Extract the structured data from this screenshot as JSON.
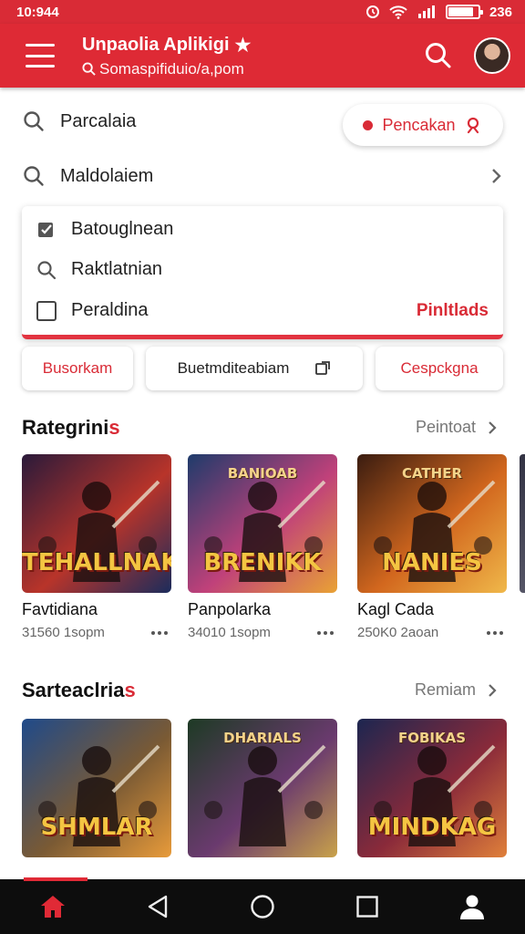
{
  "status": {
    "time": "10:944",
    "battery_text": "236",
    "battery_level": 0.85
  },
  "appbar": {
    "title": "Unpaolia Aplikigi",
    "subtitle": "Somaspifiduio/a,pom"
  },
  "search_rows": [
    {
      "label": "Parcalaia"
    },
    {
      "label": "Maldolaiem"
    }
  ],
  "pill": {
    "label": "Pencakan"
  },
  "dropdown": {
    "items": [
      {
        "label": "Batouglnean"
      },
      {
        "label": "Raktlatnian"
      },
      {
        "label": "Peraldina"
      }
    ],
    "action": "Pinltlads"
  },
  "chips": [
    {
      "label": "Busorkam"
    },
    {
      "label": "Buetmditeabiam"
    },
    {
      "label": "Cespckgna"
    }
  ],
  "sections": [
    {
      "title": "Rategrini",
      "title_accent": "s",
      "link": "Peintoat",
      "cards": [
        {
          "name": "Favtidiana",
          "meta": "31560 1sopm",
          "logo": "TEHALLNAK",
          "logo_top": "",
          "colors": [
            "#2a1a3a",
            "#b8342a",
            "#1b2c5c"
          ]
        },
        {
          "name": "Panpolarka",
          "meta": "34010 1sopm",
          "logo": "BRENIKK",
          "logo_top": "BANIOAB",
          "colors": [
            "#1e3b6b",
            "#c0417a",
            "#e9a234"
          ]
        },
        {
          "name": "Kagl Cada",
          "meta": "250K0 2aoan",
          "logo": "NANIES",
          "logo_top": "CATHER",
          "colors": [
            "#3a1c10",
            "#d2671e",
            "#f0b84a"
          ]
        }
      ]
    },
    {
      "title": "Sarteaclria",
      "title_accent": "s",
      "link": "Remiam",
      "cards": [
        {
          "name": "",
          "meta": "",
          "logo": "SHMLAR",
          "logo_top": "",
          "colors": [
            "#1f4a8a",
            "#7a5a34",
            "#e89b3a"
          ]
        },
        {
          "name": "",
          "meta": "",
          "logo": "",
          "logo_top": "DHARIALS",
          "colors": [
            "#1d3a24",
            "#6a3a6e",
            "#c9a24a"
          ]
        },
        {
          "name": "",
          "meta": "",
          "logo": "MINDKAG",
          "logo_top": "FOBIKAS",
          "colors": [
            "#1c2650",
            "#8a2a3a",
            "#e0803a"
          ]
        }
      ]
    }
  ],
  "colors": {
    "accent": "#d92b36",
    "navbar": "#0d0d0d"
  },
  "icons": [
    "menu-icon",
    "search-icon",
    "avatar",
    "chevron-right-icon",
    "check-icon",
    "checkbox-icon",
    "edit-icon",
    "more-icon",
    "home-icon",
    "back-icon",
    "circle-home-icon",
    "square-recents-icon",
    "profile-icon"
  ]
}
